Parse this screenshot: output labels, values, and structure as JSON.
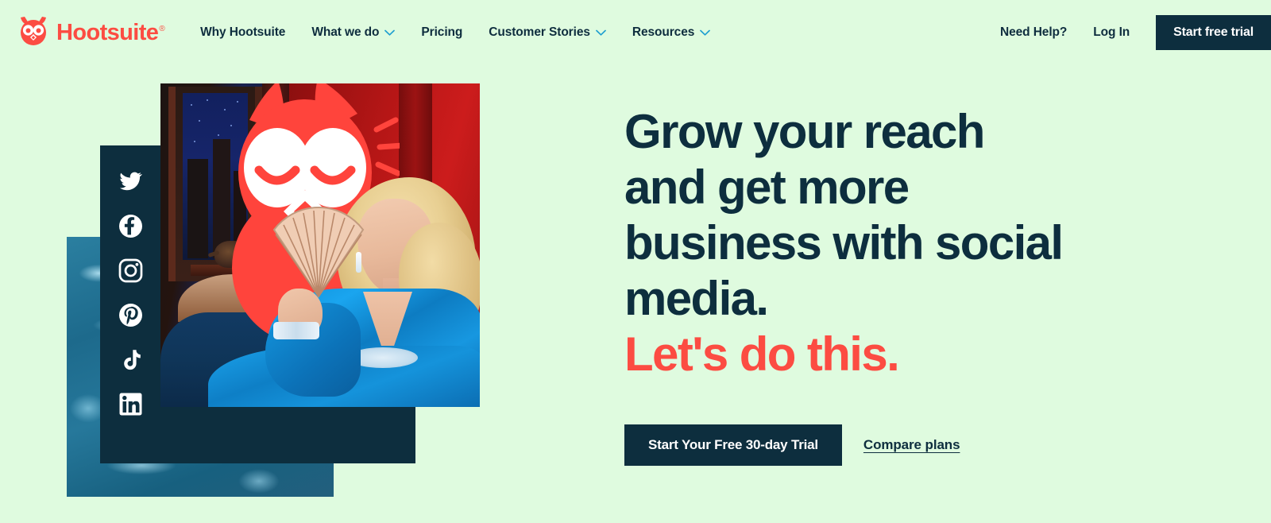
{
  "brand": {
    "name": "Hootsuite",
    "trademark": "®",
    "logo_icon": "hootsuite-owl-logo-icon",
    "accent_red": "#fc4c42",
    "dark_navy": "#0d2e3e",
    "background_green": "#dffbdf"
  },
  "header": {
    "nav": [
      {
        "label": "Why Hootsuite",
        "has_dropdown": false
      },
      {
        "label": "What we do",
        "has_dropdown": true
      },
      {
        "label": "Pricing",
        "has_dropdown": false
      },
      {
        "label": "Customer Stories",
        "has_dropdown": true
      },
      {
        "label": "Resources",
        "has_dropdown": true
      }
    ],
    "need_help": "Need Help?",
    "log_in": "Log In",
    "trial_button": "Start free trial"
  },
  "hero": {
    "headline_line1": "Grow your reach",
    "headline_line2": "and get more",
    "headline_line3": "business with social",
    "headline_line4": "media.",
    "headline_accent": "Let's do this.",
    "cta_button": "Start Your Free 30-day Trial",
    "cta_link": "Compare plans"
  },
  "social_rail": {
    "items": [
      {
        "name": "twitter",
        "label": "Twitter"
      },
      {
        "name": "facebook",
        "label": "Facebook"
      },
      {
        "name": "instagram",
        "label": "Instagram"
      },
      {
        "name": "pinterest",
        "label": "Pinterest"
      },
      {
        "name": "tiktok",
        "label": "TikTok"
      },
      {
        "name": "linkedin",
        "label": "LinkedIn"
      }
    ]
  },
  "collage": {
    "photo_alt": "Blonde woman in blue satin gown holding a folding fan, with red Hootsuite owl mascot overlay on a red interior background",
    "water_alt": "Rippling pool water texture panel"
  }
}
